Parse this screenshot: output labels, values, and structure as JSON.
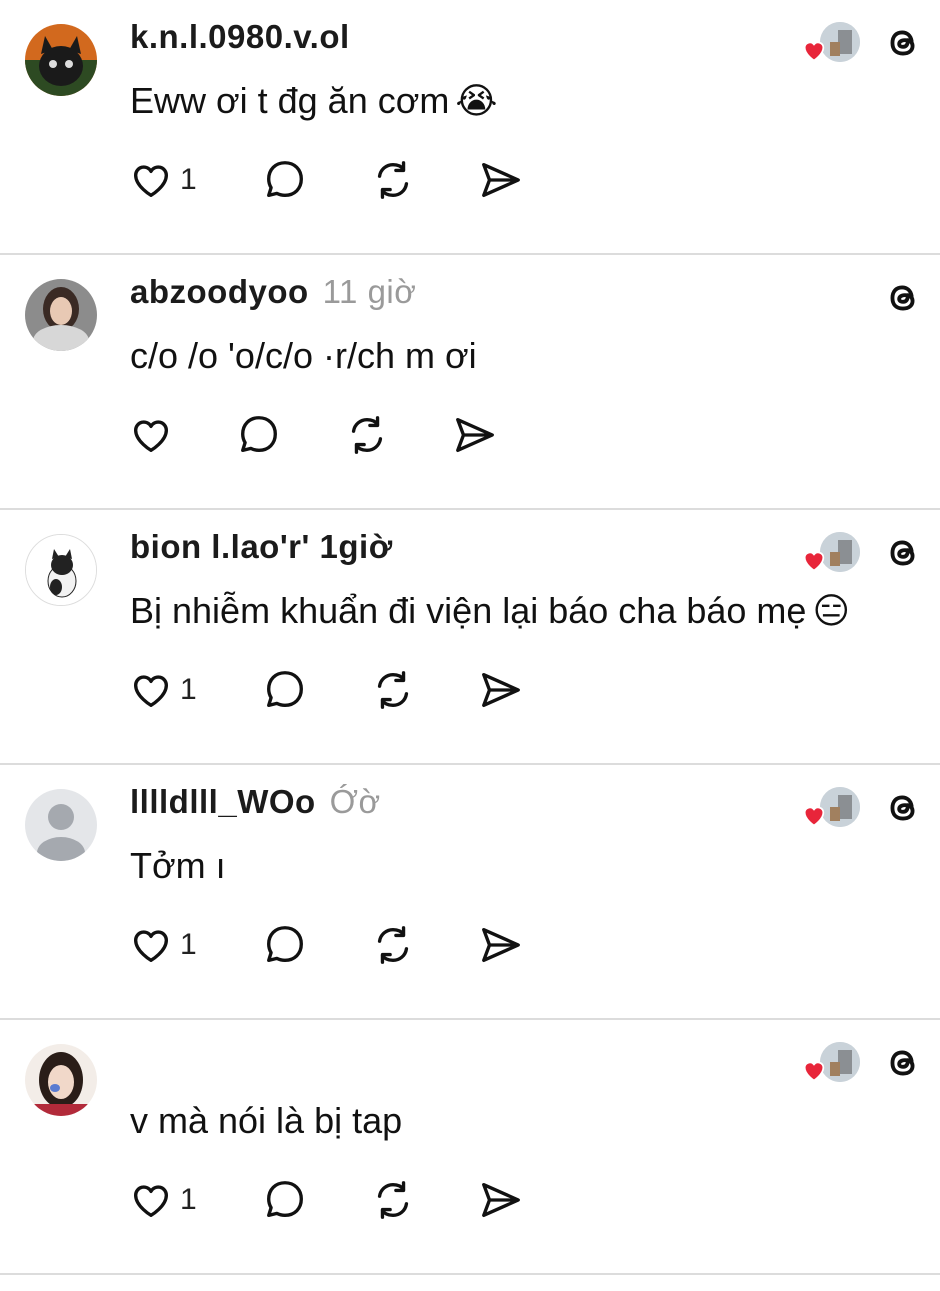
{
  "posts": [
    {
      "username": "k.n.l.0980.v.ol",
      "time": "",
      "text": "Eww ơi t đg ăn cơm",
      "emoji": "😭",
      "like_count": "1",
      "avatar": "black-cat-avatar",
      "author_liked": true
    },
    {
      "username": "abzoodyoo",
      "time": "11 giờ",
      "text": "c/o  /o 'o/c/o   ·r/ch m ơi",
      "emoji": "",
      "like_count": "",
      "avatar": "girl-scarf-avatar",
      "author_liked": false
    },
    {
      "username": "bion l.lao'r' 1giờ",
      "time": "",
      "text": "Bị nhiễm khuẩn đi viện lại báo cha báo mẹ",
      "emoji": "😑",
      "like_count": "1",
      "avatar": "cat-photo-avatar",
      "author_liked": true
    },
    {
      "username": "lllldlll_WOo",
      "time": "Ớờ",
      "text": "Tởm ı",
      "emoji": "",
      "like_count": "1",
      "avatar": "default-person-avatar",
      "author_liked": true
    },
    {
      "username": "",
      "time": "",
      "text": "v mà nói là bị tap",
      "emoji": "",
      "like_count": "1",
      "avatar": "girl-portrait-avatar",
      "author_liked": true
    }
  ],
  "icons": {
    "like": "heart-outline-icon",
    "reply": "speech-bubble-icon",
    "repost": "repost-icon",
    "share": "send-icon",
    "brand": "threads-logo-icon",
    "liked_badge": "red-heart-icon"
  },
  "colors": {
    "heart_red": "#e8253a",
    "divider": "#dcdcdc",
    "muted_text": "#9a9a9a"
  }
}
